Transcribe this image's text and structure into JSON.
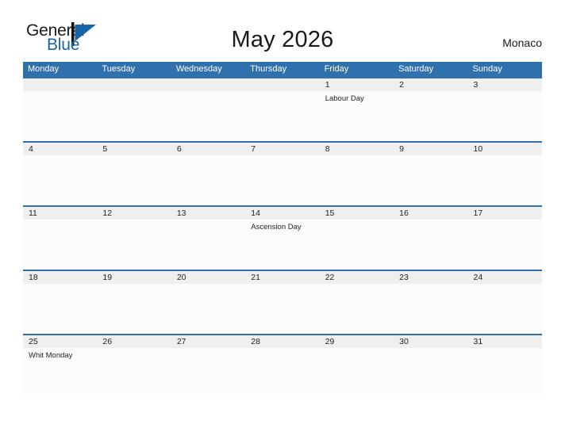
{
  "brand": {
    "name_part1": "General",
    "name_part2": "Blue",
    "flag_icon": "blue-triangle-flag-icon",
    "accent_color": "#1565a8"
  },
  "header": {
    "title": "May 2026",
    "region": "Monaco"
  },
  "theme": {
    "header_blue": "#3070ad",
    "date_band_gray": "#efefef",
    "cell_background": "#fcfcfd",
    "page_background": "#ffffff",
    "text_color": "#222222"
  },
  "calendar": {
    "weekdays": [
      "Monday",
      "Tuesday",
      "Wednesday",
      "Thursday",
      "Friday",
      "Saturday",
      "Sunday"
    ],
    "weeks": [
      {
        "days": [
          {
            "date": "",
            "event": ""
          },
          {
            "date": "",
            "event": ""
          },
          {
            "date": "",
            "event": ""
          },
          {
            "date": "",
            "event": ""
          },
          {
            "date": "1",
            "event": "Labour Day"
          },
          {
            "date": "2",
            "event": ""
          },
          {
            "date": "3",
            "event": ""
          }
        ]
      },
      {
        "days": [
          {
            "date": "4",
            "event": ""
          },
          {
            "date": "5",
            "event": ""
          },
          {
            "date": "6",
            "event": ""
          },
          {
            "date": "7",
            "event": ""
          },
          {
            "date": "8",
            "event": ""
          },
          {
            "date": "9",
            "event": ""
          },
          {
            "date": "10",
            "event": ""
          }
        ]
      },
      {
        "days": [
          {
            "date": "11",
            "event": ""
          },
          {
            "date": "12",
            "event": ""
          },
          {
            "date": "13",
            "event": ""
          },
          {
            "date": "14",
            "event": "Ascension Day"
          },
          {
            "date": "15",
            "event": ""
          },
          {
            "date": "16",
            "event": ""
          },
          {
            "date": "17",
            "event": ""
          }
        ]
      },
      {
        "days": [
          {
            "date": "18",
            "event": ""
          },
          {
            "date": "19",
            "event": ""
          },
          {
            "date": "20",
            "event": ""
          },
          {
            "date": "21",
            "event": ""
          },
          {
            "date": "22",
            "event": ""
          },
          {
            "date": "23",
            "event": ""
          },
          {
            "date": "24",
            "event": ""
          }
        ]
      },
      {
        "days": [
          {
            "date": "25",
            "event": "Whit Monday"
          },
          {
            "date": "26",
            "event": ""
          },
          {
            "date": "27",
            "event": ""
          },
          {
            "date": "28",
            "event": ""
          },
          {
            "date": "29",
            "event": ""
          },
          {
            "date": "30",
            "event": ""
          },
          {
            "date": "31",
            "event": ""
          }
        ]
      }
    ]
  }
}
